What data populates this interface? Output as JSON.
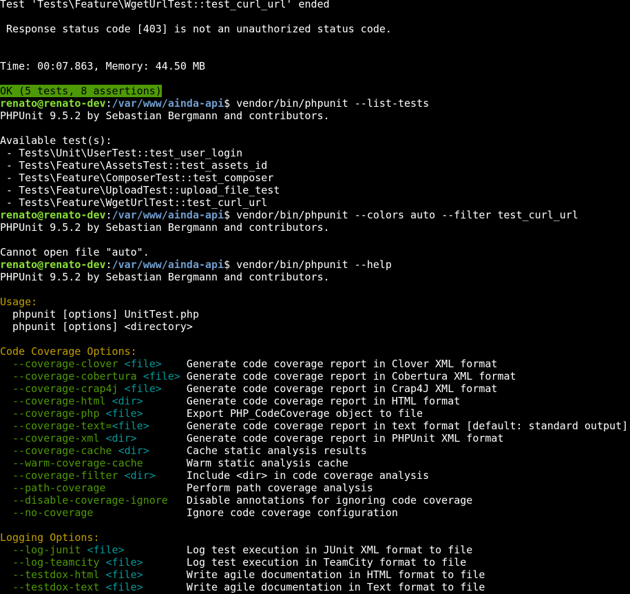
{
  "colors": {
    "background": "#000000",
    "foreground": "#ffffff",
    "prompt_user": "#8ae234",
    "prompt_path": "#729fcf",
    "ok_background": "#4e9a06",
    "heading": "#c4a000",
    "option_flag": "#4e9a06",
    "option_arg": "#06989a"
  },
  "prompt": {
    "user_host": "renato@renato-dev",
    "sep": ":",
    "path": "/var/www/ainda-api",
    "symbol": "$ "
  },
  "header_lines": [
    "Test 'Tests\\Feature\\WgetUrlTest::test_curl_url' ended",
    "",
    " Response status code [403] is not an unauthorized status code.",
    "",
    "",
    "Time: 00:07.863, Memory: 44.50 MB",
    ""
  ],
  "ok_result": "OK (5 tests, 8 assertions)",
  "commands": [
    {
      "cmd": "vendor/bin/phpunit --list-tests",
      "output": [
        "PHPUnit 9.5.2 by Sebastian Bergmann and contributors.",
        "",
        "Available test(s):",
        " - Tests\\Unit\\UserTest::test_user_login",
        " - Tests\\Feature\\AssetsTest::test_assets_id",
        " - Tests\\Feature\\ComposerTest::test_composer",
        " - Tests\\Feature\\UploadTest::upload_file_test",
        " - Tests\\Feature\\WgetUrlTest::test_curl_url"
      ]
    },
    {
      "cmd": "vendor/bin/phpunit --colors auto --filter test_curl_url",
      "output": [
        "PHPUnit 9.5.2 by Sebastian Bergmann and contributors.",
        "",
        "Cannot open file \"auto\"."
      ]
    },
    {
      "cmd": "vendor/bin/phpunit --help",
      "output": [
        "PHPUnit 9.5.2 by Sebastian Bergmann and contributors.",
        ""
      ]
    }
  ],
  "usage": {
    "heading": "Usage:",
    "lines": [
      "  phpunit [options] UnitTest.php",
      "  phpunit [options] <directory>"
    ]
  },
  "sections": [
    {
      "heading": "Code Coverage Options:",
      "options": [
        {
          "flag": "--coverage-clover",
          "arg": "<file>",
          "desc": "Generate code coverage report in Clover XML format"
        },
        {
          "flag": "--coverage-cobertura",
          "arg": "<file>",
          "desc": "Generate code coverage report in Cobertura XML format"
        },
        {
          "flag": "--coverage-crap4j",
          "arg": "<file>",
          "desc": "Generate code coverage report in Crap4J XML format"
        },
        {
          "flag": "--coverage-html",
          "arg": "<dir>",
          "desc": "Generate code coverage report in HTML format"
        },
        {
          "flag": "--coverage-php",
          "arg": "<file>",
          "desc": "Export PHP_CodeCoverage object to file"
        },
        {
          "flag": "--coverage-text=",
          "arg": "<file>",
          "desc": "Generate code coverage report in text format [default: standard output]"
        },
        {
          "flag": "--coverage-xml",
          "arg": "<dir>",
          "desc": "Generate code coverage report in PHPUnit XML format"
        },
        {
          "flag": "--coverage-cache",
          "arg": "<dir>",
          "desc": "Cache static analysis results"
        },
        {
          "flag": "--warm-coverage-cache",
          "arg": "",
          "desc": "Warm static analysis cache"
        },
        {
          "flag": "--coverage-filter",
          "arg": "<dir>",
          "desc": "Include <dir> in code coverage analysis"
        },
        {
          "flag": "--path-coverage",
          "arg": "",
          "desc": "Perform path coverage analysis"
        },
        {
          "flag": "--disable-coverage-ignore",
          "arg": "",
          "desc": "Disable annotations for ignoring code coverage"
        },
        {
          "flag": "--no-coverage",
          "arg": "",
          "desc": "Ignore code coverage configuration"
        }
      ]
    },
    {
      "heading": "Logging Options:",
      "options": [
        {
          "flag": "--log-junit",
          "arg": "<file>",
          "desc": "Log test execution in JUnit XML format to file"
        },
        {
          "flag": "--log-teamcity",
          "arg": "<file>",
          "desc": "Log test execution in TeamCity format to file"
        },
        {
          "flag": "--testdox-html",
          "arg": "<file>",
          "desc": "Write agile documentation in HTML format to file"
        },
        {
          "flag": "--testdox-text",
          "arg": "<file>",
          "desc": "Write agile documentation in Text format to file"
        }
      ]
    }
  ]
}
